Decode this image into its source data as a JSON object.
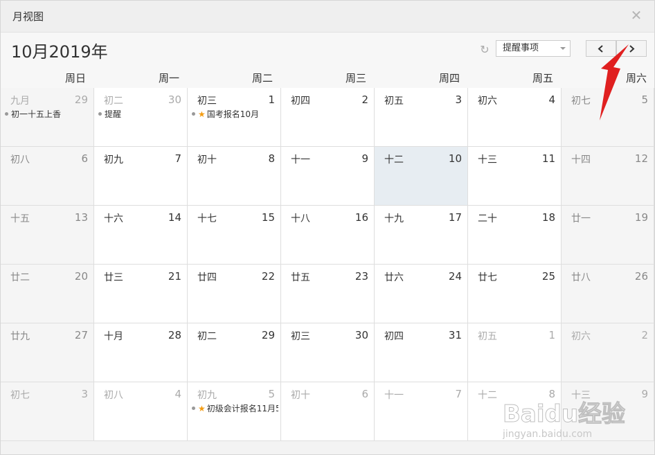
{
  "window": {
    "title": "月视图"
  },
  "toolbar": {
    "month_title": "10月2019年",
    "select_value": "提醒事项"
  },
  "weekdays": [
    "周日",
    "周一",
    "周二",
    "周三",
    "周四",
    "周五",
    "周六"
  ],
  "weeks": [
    [
      {
        "lunar": "九月",
        "day": "29",
        "other": true,
        "event": {
          "text": "初一十五上香",
          "star": false
        }
      },
      {
        "lunar": "初二",
        "day": "30",
        "other": true,
        "event": {
          "text": "提醒",
          "star": false
        }
      },
      {
        "lunar": "初三",
        "day": "1",
        "other": false,
        "event": {
          "text": "国考报名10月",
          "star": true
        }
      },
      {
        "lunar": "初四",
        "day": "2",
        "other": false
      },
      {
        "lunar": "初五",
        "day": "3",
        "other": false
      },
      {
        "lunar": "初六",
        "day": "4",
        "other": false
      },
      {
        "lunar": "初七",
        "day": "5",
        "other": false
      }
    ],
    [
      {
        "lunar": "初八",
        "day": "6",
        "other": false
      },
      {
        "lunar": "初九",
        "day": "7",
        "other": false
      },
      {
        "lunar": "初十",
        "day": "8",
        "other": false
      },
      {
        "lunar": "十一",
        "day": "9",
        "other": false
      },
      {
        "lunar": "十二",
        "day": "10",
        "other": false,
        "today": true
      },
      {
        "lunar": "十三",
        "day": "11",
        "other": false
      },
      {
        "lunar": "十四",
        "day": "12",
        "other": false
      }
    ],
    [
      {
        "lunar": "十五",
        "day": "13",
        "other": false
      },
      {
        "lunar": "十六",
        "day": "14",
        "other": false
      },
      {
        "lunar": "十七",
        "day": "15",
        "other": false
      },
      {
        "lunar": "十八",
        "day": "16",
        "other": false
      },
      {
        "lunar": "十九",
        "day": "17",
        "other": false
      },
      {
        "lunar": "二十",
        "day": "18",
        "other": false
      },
      {
        "lunar": "廿一",
        "day": "19",
        "other": false
      }
    ],
    [
      {
        "lunar": "廿二",
        "day": "20",
        "other": false
      },
      {
        "lunar": "廿三",
        "day": "21",
        "other": false
      },
      {
        "lunar": "廿四",
        "day": "22",
        "other": false
      },
      {
        "lunar": "廿五",
        "day": "23",
        "other": false
      },
      {
        "lunar": "廿六",
        "day": "24",
        "other": false
      },
      {
        "lunar": "廿七",
        "day": "25",
        "other": false
      },
      {
        "lunar": "廿八",
        "day": "26",
        "other": false
      }
    ],
    [
      {
        "lunar": "廿九",
        "day": "27",
        "other": false
      },
      {
        "lunar": "十月",
        "day": "28",
        "other": false
      },
      {
        "lunar": "初二",
        "day": "29",
        "other": false
      },
      {
        "lunar": "初三",
        "day": "30",
        "other": false
      },
      {
        "lunar": "初四",
        "day": "31",
        "other": false
      },
      {
        "lunar": "初五",
        "day": "1",
        "other": true
      },
      {
        "lunar": "初六",
        "day": "2",
        "other": true
      }
    ],
    [
      {
        "lunar": "初七",
        "day": "3",
        "other": true
      },
      {
        "lunar": "初八",
        "day": "4",
        "other": true
      },
      {
        "lunar": "初九",
        "day": "5",
        "other": true,
        "event": {
          "text": "初级会计报名11月5",
          "star": true
        }
      },
      {
        "lunar": "初十",
        "day": "6",
        "other": true
      },
      {
        "lunar": "十一",
        "day": "7",
        "other": true
      },
      {
        "lunar": "十二",
        "day": "8",
        "other": true
      },
      {
        "lunar": "十三",
        "day": "9",
        "other": true
      }
    ]
  ],
  "watermark": {
    "brand": "Baidu经验",
    "url": "jingyan.baidu.com"
  },
  "colors": {
    "today_bg": "#e7edf2",
    "arrow": "#e02020",
    "star": "#f39c12"
  }
}
